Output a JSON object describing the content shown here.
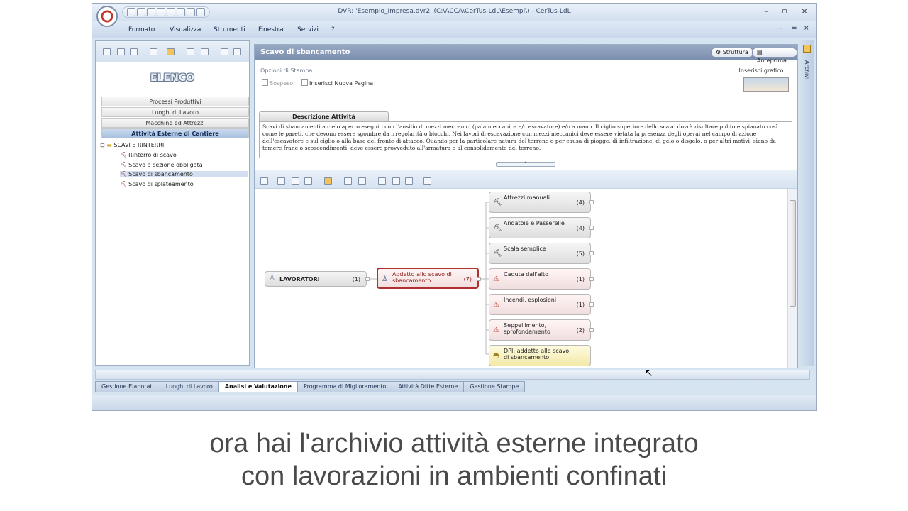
{
  "window": {
    "title": "DVR: 'Esempio_Impresa.dvr2'   (C:\\ACCA\\CerTus-LdL\\Esempi\\) - CerTus-LdL",
    "minimize": "–",
    "maximize": "▫",
    "close": "×"
  },
  "menu": {
    "items": [
      "Formato",
      "Visualizza",
      "Strumenti",
      "Finestra",
      "Servizi",
      "?"
    ]
  },
  "left": {
    "heading": "ELENCO",
    "categories": [
      "Processi Produttivi",
      "Luoghi di Lavoro",
      "Macchine ed Attrezzi",
      "Attività Esterne di Cantiere"
    ],
    "tree_root": "SCAVI E RINTERRI",
    "tree_items": [
      "Rinterro di scavo",
      "Scavo a sezione obbligata",
      "Scavo di sbancamento",
      "Scavo di splateamento"
    ]
  },
  "main": {
    "title": "Scavo di sbancamento",
    "struttura_btn": "Struttura",
    "anteprima_btn": "Anteprima",
    "options_label": "Opzioni di Stampa",
    "sospeso": "Sospeso",
    "nuova_pagina": "Inserisci Nuova Pagina",
    "inserisci_grafico": "Inserisci grafico...",
    "desc_tab": "Descrizione Attività",
    "description": "Scavi di sbancamenti a cielo aperto eseguiti con l'ausilio di mezzi meccanici (pala meccanica e/o escavatore) e/o a mano. Il ciglio superiore dello scavo dovrà risultare pulito e spianato così come le pareti, che devono essere sgombre da irregolarità o blocchi. Nei lavori di escavazione con mezzi meccanici deve essere vietata la presenza degli operai nel campo di azione dell'escavatore e sul ciglio o alla base del fronte di attacco. Quando per la particolare natura del terreno o per causa di piogge, di infiltrazione, di gelo o disgelo, o per altri motivi, siano da temere frane o scoscendimenti, deve essere provveduto all'armatura o al consolidamento del terreno."
  },
  "graph": {
    "root": {
      "label": "LAVORATORI",
      "count": "(1)"
    },
    "worker": {
      "label": "Addetto allo scavo di sbancamento",
      "count": "(7)"
    },
    "children": [
      {
        "label": "Attrezzi manuali",
        "count": "(4)",
        "kind": "tool"
      },
      {
        "label": "Andatoie e Passerelle",
        "count": "(4)",
        "kind": "tool"
      },
      {
        "label": "Scala semplice",
        "count": "(5)",
        "kind": "tool"
      },
      {
        "label": "Caduta dall'alto",
        "count": "(1)",
        "kind": "risk"
      },
      {
        "label": "Incendi, esplosioni",
        "count": "(1)",
        "kind": "risk"
      },
      {
        "label": "Seppellimento, sprofondamento",
        "count": "(2)",
        "kind": "risk"
      },
      {
        "label": "DPI: addetto allo scavo di sbancamento",
        "count": "",
        "kind": "dpi"
      }
    ]
  },
  "tabs": [
    "Gestione Elaborati",
    "Luoghi di Lavoro",
    "Analisi e Valutazione",
    "Programma di Miglioramento",
    "Attività Ditte Esterne",
    "Gestione Stampe"
  ],
  "right_strip": "Archivi",
  "caption": {
    "line1": "ora hai l'archivio attività esterne integrato",
    "line2": "con lavorazioni in ambienti confinati"
  },
  "colors": {
    "accent": "#7a8eae",
    "risk": "#c0392b",
    "selected_border": "#b03030"
  }
}
